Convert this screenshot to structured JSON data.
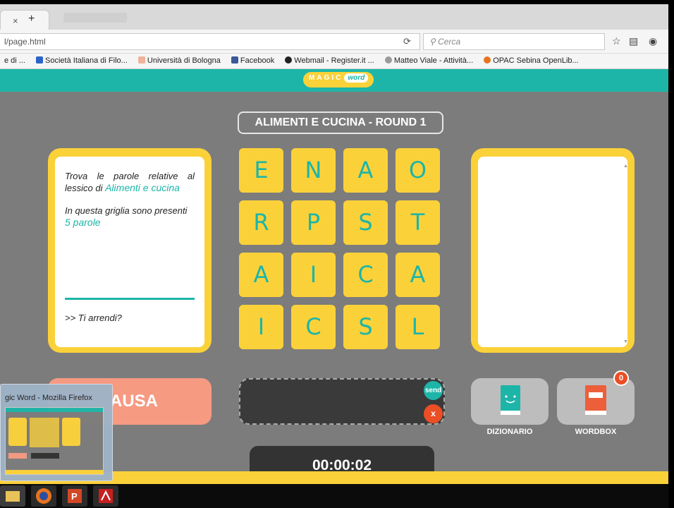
{
  "browser": {
    "tab_close": "×",
    "tab_new": "+",
    "url": "l/page.html",
    "search_placeholder": "Cerca",
    "bookmarks": [
      "e di ...",
      "Società Italiana di Filo...",
      "Università di Bologna",
      "Facebook",
      "Webmail - Register.it ...",
      "Matteo Viale - Attività...",
      "OPAC Sebina OpenLib..."
    ]
  },
  "site": {
    "logo_magic": "MAGIC",
    "logo_word": "word"
  },
  "game": {
    "round_title": "ALIMENTI E CUCINA - ROUND 1",
    "info": {
      "line1": "Trova le parole relative al lessico di",
      "topic": "Alimenti e cucina",
      "line2": "In questa griglia sono presenti",
      "count": "5 parole",
      "give_up": ">> Ti arrendi?"
    },
    "grid": [
      [
        "E",
        "N",
        "A",
        "O"
      ],
      [
        "R",
        "P",
        "S",
        "T"
      ],
      [
        "A",
        "I",
        "C",
        "A"
      ],
      [
        "I",
        "C",
        "S",
        "L"
      ]
    ],
    "pause_label": "AUSA",
    "send_label": "send",
    "clear_label": "x",
    "dictionary_label": "DIZIONARIO",
    "wordbox_label": "WORDBOX",
    "wordbox_count": "0",
    "timer": "00:00:02"
  },
  "taskbar": {
    "preview_title": "gic Word - Mozilla Firefox"
  },
  "colors": {
    "teal": "#1db5a8",
    "yellow": "#fbd13a",
    "gray": "#7c7c7c",
    "salmon": "#f69a82",
    "red": "#ec4e25"
  }
}
